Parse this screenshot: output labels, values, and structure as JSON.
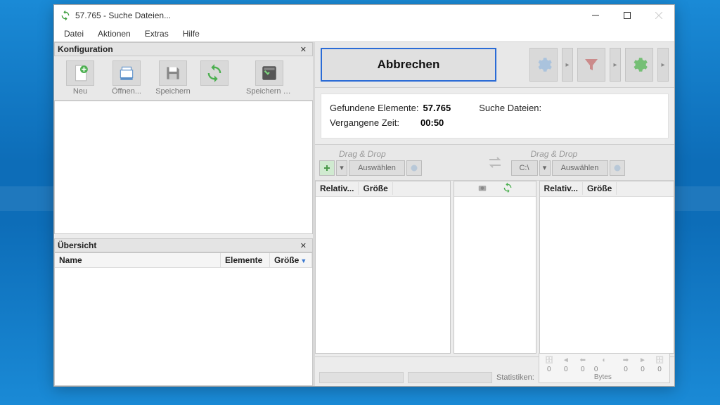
{
  "title": "57.765 - Suche Dateien...",
  "menubar": [
    "Datei",
    "Aktionen",
    "Extras",
    "Hilfe"
  ],
  "config": {
    "header": "Konfiguration",
    "tools": [
      {
        "name": "neu",
        "label": "Neu"
      },
      {
        "name": "oeffnen",
        "label": "Öffnen..."
      },
      {
        "name": "speichern",
        "label": "Speichern"
      },
      {
        "name": "speichern-unter",
        "label": "Speichern unter..."
      }
    ]
  },
  "overview": {
    "header": "Übersicht",
    "cols": {
      "name": "Name",
      "elements": "Elemente",
      "size": "Größe"
    }
  },
  "action": {
    "cancel": "Abbrechen"
  },
  "status": {
    "found_label": "Gefundene Elemente:",
    "found_value": "57.765",
    "time_label": "Vergangene Zeit:",
    "time_value": "00:50",
    "search_label": "Suche Dateien:"
  },
  "dragdrop": {
    "label": "Drag & Drop",
    "select": "Auswählen",
    "path": "C:\\"
  },
  "results": {
    "rel": "Relativ...",
    "size": "Größe"
  },
  "stats": {
    "label": "Statistiken:",
    "v0": "0",
    "v1": "0",
    "v2": "0",
    "v3": "0 Bytes",
    "v4": "0",
    "v5": "0",
    "v6": "0"
  }
}
